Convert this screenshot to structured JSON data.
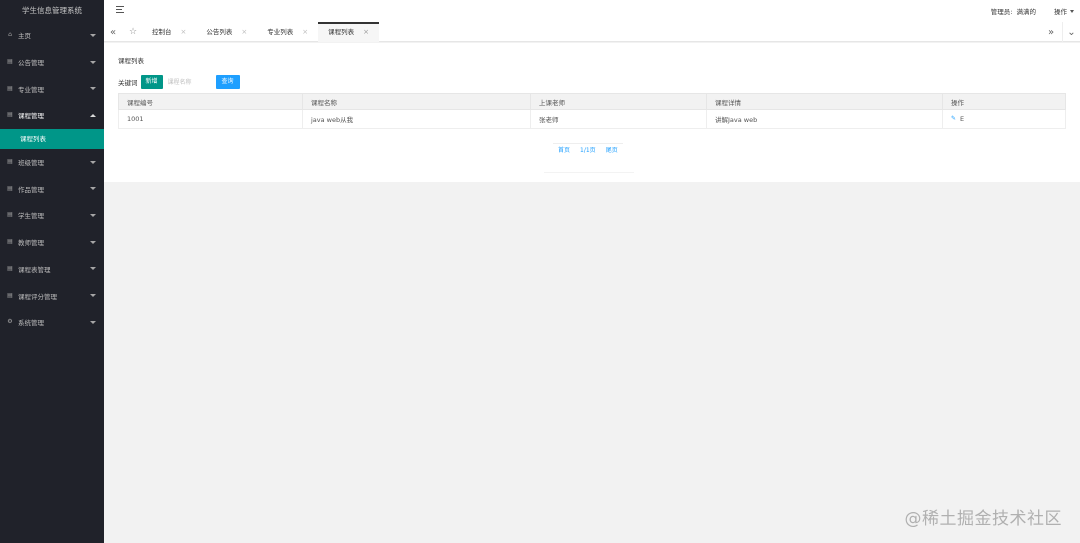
{
  "app": {
    "title": "学生信息管理系统"
  },
  "sidebar": {
    "items": [
      {
        "label": "主页",
        "icon": "home-icon"
      },
      {
        "label": "公告管理",
        "icon": "grid-icon"
      },
      {
        "label": "专业管理",
        "icon": "grid-icon"
      },
      {
        "label": "课程管理",
        "icon": "grid-icon",
        "open": true,
        "children": [
          {
            "label": "课程列表"
          }
        ]
      },
      {
        "label": "班级管理",
        "icon": "grid-icon"
      },
      {
        "label": "作品管理",
        "icon": "grid-icon"
      },
      {
        "label": "学生管理",
        "icon": "grid-icon"
      },
      {
        "label": "教师管理",
        "icon": "grid-icon"
      },
      {
        "label": "课程表管理",
        "icon": "grid-icon"
      },
      {
        "label": "课程评分管理",
        "icon": "grid-icon"
      },
      {
        "label": "系统管理",
        "icon": "gear-icon"
      }
    ]
  },
  "header": {
    "admin_label": "管理员:",
    "admin_name": "满满的",
    "ops_label": "操作"
  },
  "tabs": [
    {
      "label": "控制台",
      "active": false
    },
    {
      "label": "公告列表",
      "active": false
    },
    {
      "label": "专业列表",
      "active": false
    },
    {
      "label": "课程列表",
      "active": true
    }
  ],
  "page": {
    "title": "课程列表",
    "keyword_label": "关键词",
    "add_button": "新增",
    "search_placeholder": "课程名称",
    "search_button": "查询"
  },
  "table": {
    "columns": [
      "课程编号",
      "课程名称",
      "上课老师",
      "课程详情",
      "操作"
    ],
    "rows": [
      {
        "id": "1001",
        "name": "java web从我",
        "teacher": "张老师",
        "detail": "讲解Java web",
        "action": "E"
      }
    ]
  },
  "pager": {
    "first": "首页",
    "info": "1/1页",
    "last": "尾页"
  },
  "watermark": "@稀土掘金技术社区",
  "colors": {
    "sidebar_bg": "#20222a",
    "accent_green": "#009688",
    "accent_blue": "#1e9fff"
  }
}
